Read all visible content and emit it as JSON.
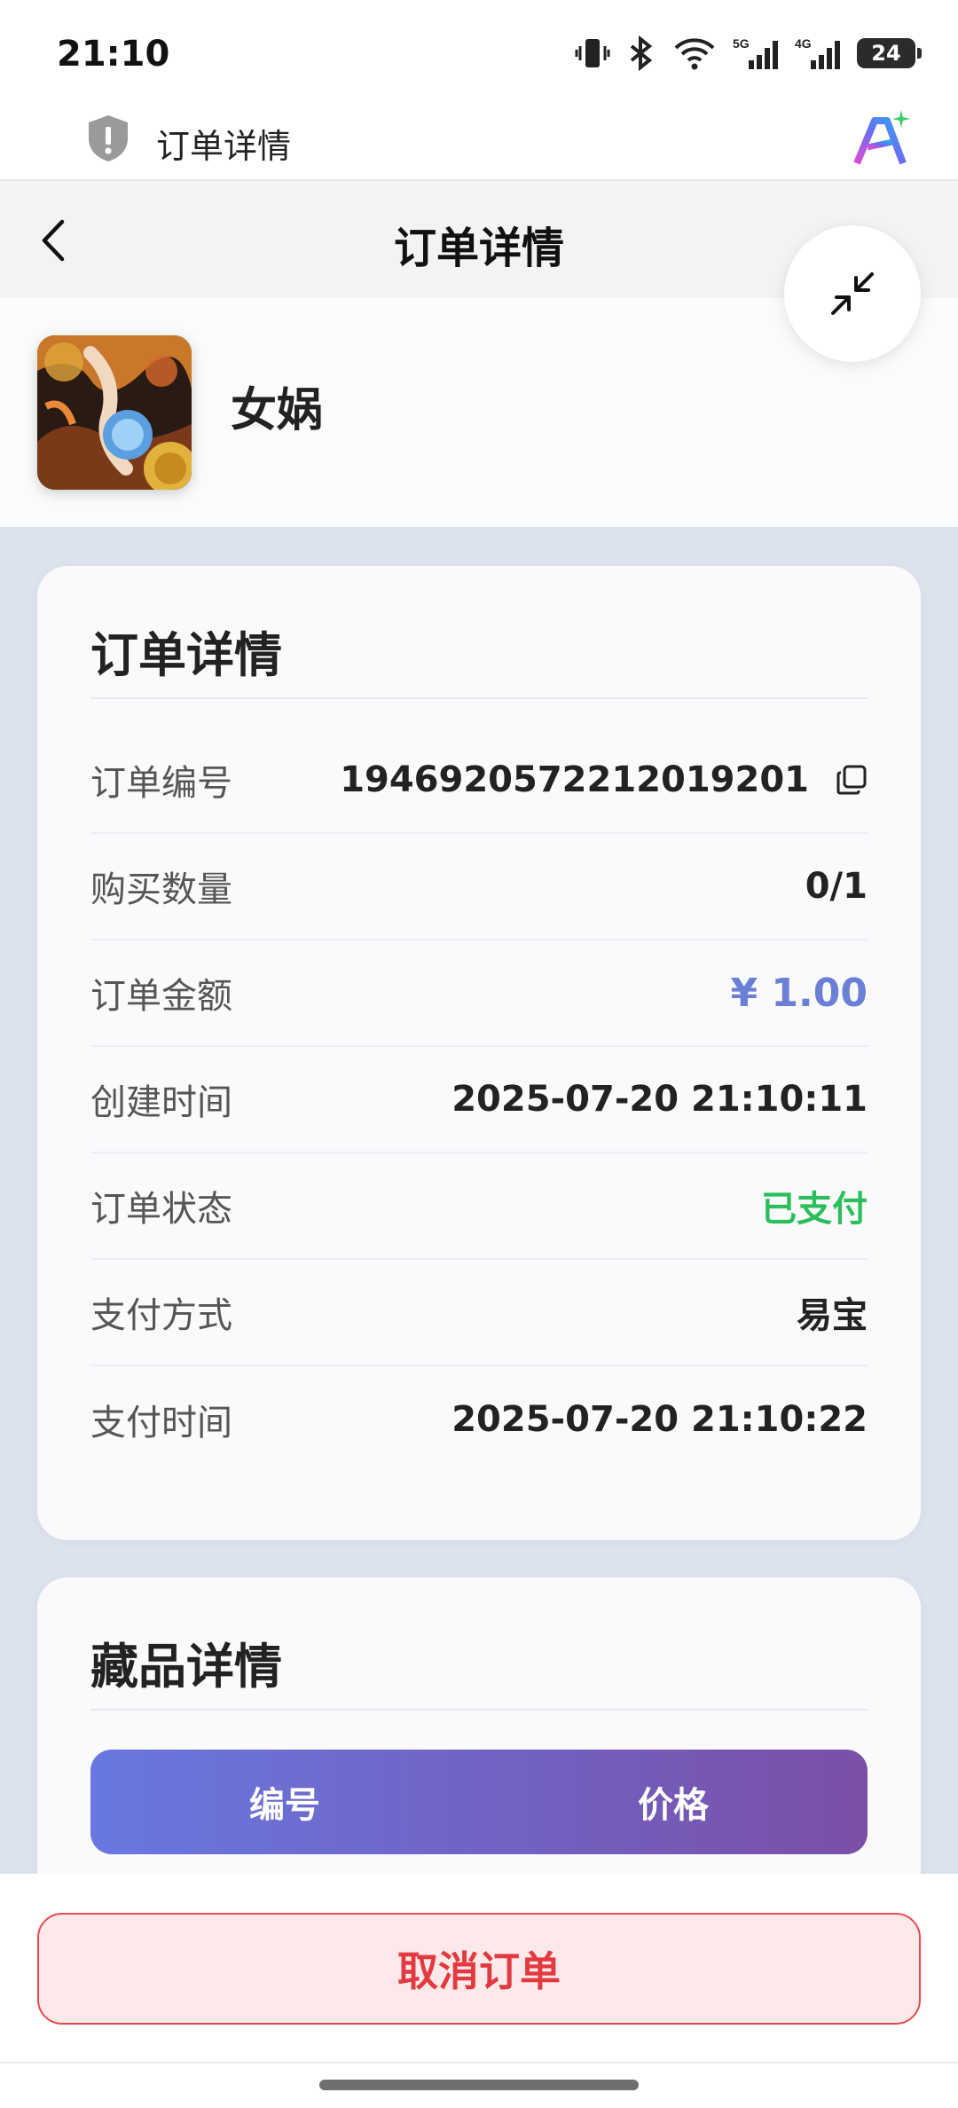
{
  "status_bar": {
    "time": "21:10",
    "battery": "24"
  },
  "browser": {
    "title": "订单详情"
  },
  "nav": {
    "title": "订单详情"
  },
  "product": {
    "name": "女娲"
  },
  "order_card": {
    "title": "订单详情",
    "rows": [
      {
        "label": "订单编号",
        "value": "1946920572212019201"
      },
      {
        "label": "购买数量",
        "value": "0/1"
      },
      {
        "label": "订单金额",
        "value": "¥ 1.00"
      },
      {
        "label": "创建时间",
        "value": "2025-07-20 21:10:11"
      },
      {
        "label": "订单状态",
        "value": "已支付"
      },
      {
        "label": "支付方式",
        "value": "易宝"
      },
      {
        "label": "支付时间",
        "value": "2025-07-20 21:10:22"
      }
    ]
  },
  "collectible_card": {
    "title": "藏品详情",
    "columns": [
      "编号",
      "价格"
    ]
  },
  "actions": {
    "cancel": "取消订单"
  },
  "colors": {
    "accent": "#6a7fd6",
    "paid": "#2cbe5a",
    "danger": "#e23a40",
    "gradient_start": "#6878e0",
    "gradient_end": "#7a4fa8"
  }
}
